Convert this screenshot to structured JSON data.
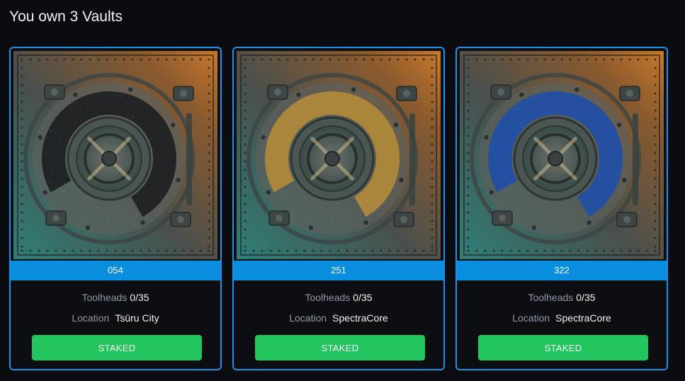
{
  "header": {
    "title": "You own 3 Vaults"
  },
  "vaults": [
    {
      "id": "054",
      "toolheads_label": "Toolheads",
      "toolheads_value": "0/35",
      "location_label": "Location",
      "location_value": "Tsūru City",
      "button_label": "STAKED",
      "ring_color": "#1d1f22"
    },
    {
      "id": "251",
      "toolheads_label": "Toolheads",
      "toolheads_value": "0/35",
      "location_label": "Location",
      "location_value": "SpectraCore",
      "button_label": "STAKED",
      "ring_color": "#b08a3a"
    },
    {
      "id": "322",
      "toolheads_label": "Toolheads",
      "toolheads_value": "0/35",
      "location_label": "Location",
      "location_value": "SpectraCore",
      "button_label": "STAKED",
      "ring_color": "#1f4fa6"
    }
  ],
  "colors": {
    "card_border": "#1e90e8",
    "id_bar": "#0a8ee0",
    "staked_button": "#22c55e",
    "background": "#0b0c0f"
  }
}
